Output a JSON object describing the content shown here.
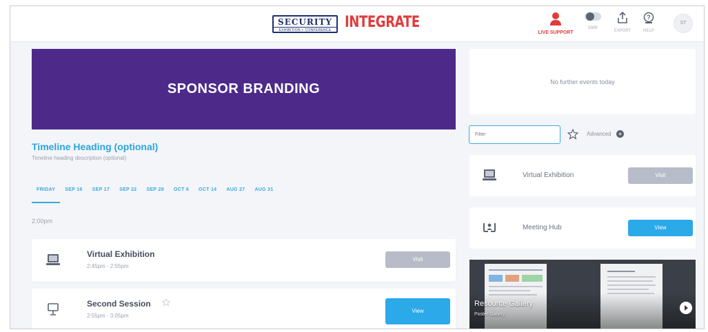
{
  "header": {
    "logo_security": "SECURITY",
    "logo_security_sub": "EXHIBITION + CONFERENCE",
    "logo_integrate": "INTEGRATE",
    "live_support_label": "LIVE SUPPORT",
    "dmr_label": "DMR",
    "export_label": "EXPORT",
    "help_label": "HELP",
    "avatar_initials": "ST",
    "accent_color": "#e33a3a"
  },
  "main": {
    "sponsor_label": "SPONSOR BRANDING",
    "sponsor_color": "#4d2a8a",
    "timeline_heading": "Timeline Heading (optional)",
    "timeline_description": "Timeline heading description (optional)",
    "tabs": [
      {
        "label": "FRIDAY",
        "active": true
      },
      {
        "label": "SEP 16"
      },
      {
        "label": "SEP 17"
      },
      {
        "label": "SEP 22"
      },
      {
        "label": "SEP 28"
      },
      {
        "label": "OCT 6"
      },
      {
        "label": "OCT 14"
      },
      {
        "label": "AUG 27"
      },
      {
        "label": "AUG 31"
      }
    ],
    "time_label": "2:00pm",
    "sessions": [
      {
        "title": "Virtual Exhibition",
        "time": "2:45pm - 2:55pm",
        "button": "Visit",
        "icon": "monitor-icon"
      },
      {
        "title": "Second Session",
        "time": "2:55pm - 3:05pm",
        "button": "View",
        "icon": "presentation-icon"
      }
    ]
  },
  "sidebar": {
    "events_message": "No further events today",
    "filter_placeholder": "Filter",
    "advanced_label": "Advanced",
    "cards": [
      {
        "title": "Virtual Exhibition",
        "button": "Visit",
        "icon": "monitor-icon"
      },
      {
        "title": "Meeting Hub",
        "button": "View",
        "icon": "meeting-hub-icon"
      }
    ],
    "gallery_title": "Resource Gallery",
    "gallery_subtitle": "Poster Gallery"
  }
}
